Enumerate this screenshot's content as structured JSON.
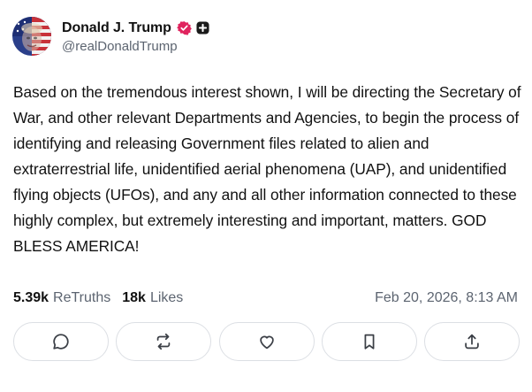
{
  "author": {
    "display_name": "Donald J. Trump",
    "handle": "@realDonaldTrump",
    "avatar_icon": "profile-photo",
    "verified_icon": "verified-badge-icon",
    "verified_color": "#e0245e",
    "extra_badge_icon": "plus-badge-icon"
  },
  "post": {
    "text": "Based on the tremendous interest shown, I will be directing the Secretary of War, and other relevant Departments and Agencies, to begin the process of identifying and releasing Government files related to alien and extraterrestrial life, unidentified aerial phenomena (UAP), and unidentified flying objects (UFOs), and any and all other information connected to these highly complex, but extremely interesting and important, matters. GOD BLESS AMERICA!",
    "retruths_count": "5.39k",
    "retruths_label": "ReTruths",
    "likes_count": "18k",
    "likes_label": "Likes",
    "timestamp": "Feb 20, 2026, 8:13 AM"
  },
  "actions": [
    {
      "name": "reply",
      "icon": "comment-icon"
    },
    {
      "name": "retruth",
      "icon": "repost-icon"
    },
    {
      "name": "like",
      "icon": "heart-icon"
    },
    {
      "name": "bookmark",
      "icon": "bookmark-icon"
    },
    {
      "name": "share",
      "icon": "share-icon"
    }
  ],
  "colors": {
    "text_primary": "#111111",
    "text_secondary": "#5c6470",
    "button_border": "#dcdfe4",
    "icon_color": "#3b3f46"
  }
}
